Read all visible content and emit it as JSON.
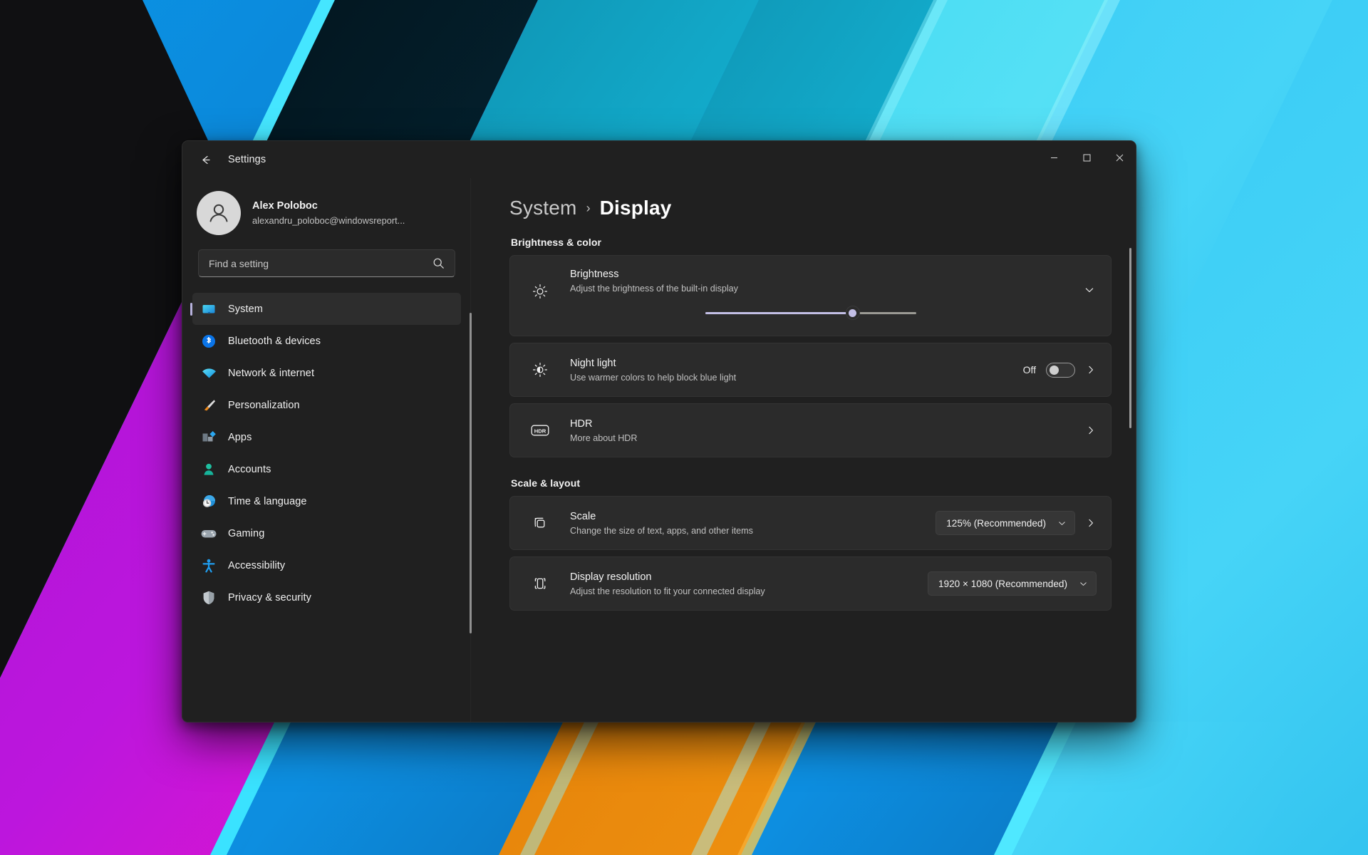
{
  "wallpaper": {
    "name": "windows-11-bloom-ribbons",
    "colors": [
      "#e07d0a",
      "#0a95e8",
      "#041d28",
      "#0d8ab0",
      "#2ad2f0",
      "#b915d8",
      "#f015c8",
      "#101010",
      "#0b5f9e"
    ]
  },
  "window": {
    "title": "Settings",
    "back_label": "Back",
    "controls": {
      "minimize": "Minimize",
      "maximize": "Maximize",
      "close": "Close"
    }
  },
  "sidebar": {
    "account": {
      "name": "Alex Poloboc",
      "email": "alexandru_poloboc@windowsreport...",
      "avatar_icon": "person-avatar-icon"
    },
    "search": {
      "placeholder": "Find a setting",
      "value": "",
      "icon": "search-icon"
    },
    "items": [
      {
        "label": "System",
        "icon": "monitor-icon",
        "active": true
      },
      {
        "label": "Bluetooth & devices",
        "icon": "bluetooth-icon",
        "active": false
      },
      {
        "label": "Network & internet",
        "icon": "wifi-icon",
        "active": false
      },
      {
        "label": "Personalization",
        "icon": "paintbrush-icon",
        "active": false
      },
      {
        "label": "Apps",
        "icon": "apps-grid-icon",
        "active": false
      },
      {
        "label": "Accounts",
        "icon": "person-icon",
        "active": false
      },
      {
        "label": "Time & language",
        "icon": "clock-globe-icon",
        "active": false
      },
      {
        "label": "Gaming",
        "icon": "gamepad-icon",
        "active": false
      },
      {
        "label": "Accessibility",
        "icon": "accessibility-person-icon",
        "active": false
      },
      {
        "label": "Privacy & security",
        "icon": "shield-icon",
        "active": false
      }
    ]
  },
  "content": {
    "breadcrumb": {
      "parent": "System",
      "separator": "›",
      "current": "Display"
    },
    "sections": [
      {
        "title": "Brightness & color",
        "rows": [
          {
            "name": "brightness",
            "icon": "sun-icon",
            "title": "Brightness",
            "subtitle": "Adjust the brightness of the built-in display",
            "expand_icon": "chevron-down-icon",
            "slider": {
              "value": 70,
              "min": 0,
              "max": 100
            }
          },
          {
            "name": "night-light",
            "icon": "night-light-sun-icon",
            "title": "Night light",
            "subtitle": "Use warmer colors to help block blue light",
            "toggle_label": "Off",
            "toggle_on": false,
            "chevron_icon": "chevron-right-icon"
          },
          {
            "name": "hdr",
            "icon": "hdr-badge-icon",
            "title": "HDR",
            "subtitle": "More about HDR",
            "chevron_icon": "chevron-right-icon"
          }
        ]
      },
      {
        "title": "Scale & layout",
        "rows": [
          {
            "name": "scale",
            "icon": "scale-resize-icon",
            "title": "Scale",
            "subtitle": "Change the size of text, apps, and other items",
            "dropdown_value": "125% (Recommended)",
            "dropdown_icon": "chevron-down-icon",
            "chevron_icon": "chevron-right-icon"
          },
          {
            "name": "display-resolution",
            "icon": "display-resolution-icon",
            "title": "Display resolution",
            "subtitle": "Adjust the resolution to fit your connected display",
            "dropdown_value": "1920 × 1080 (Recommended)",
            "dropdown_icon": "chevron-down-icon"
          }
        ]
      }
    ]
  },
  "theme": {
    "accent": "#c3bfe6",
    "window_bg": "#202020",
    "card_bg": "#2b2b2b",
    "text_primary": "#f2f2f2",
    "text_secondary": "#c0c0c0"
  }
}
